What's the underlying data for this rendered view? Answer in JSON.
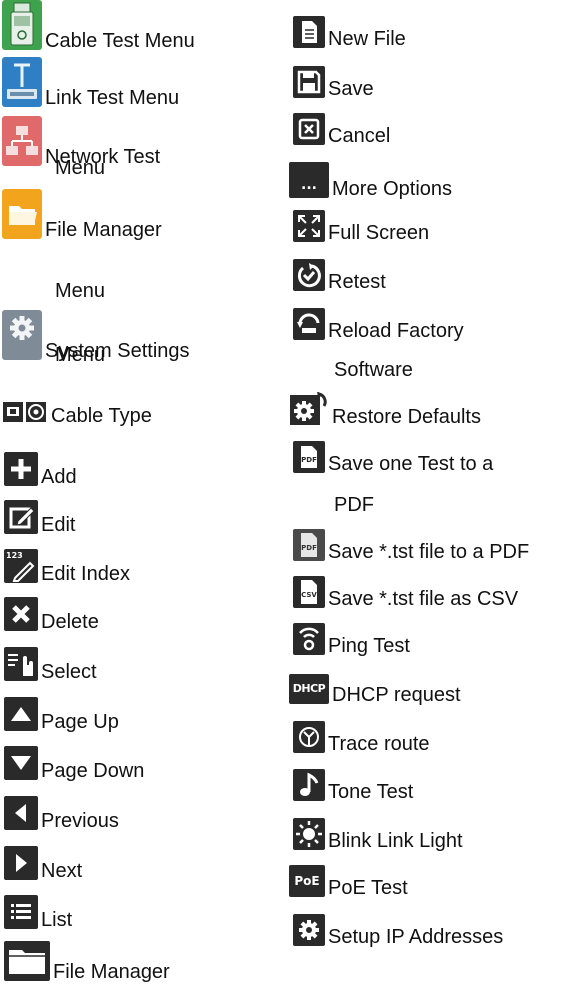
{
  "left_column": [
    {
      "icon": "cable-tester-icon",
      "label": "Cable Test Menu"
    },
    {
      "icon": "link-test-icon",
      "label": "Link Test Menu"
    },
    {
      "icon": "network-topology-icon",
      "label": "Network Test",
      "label_cont": "Menu"
    },
    {
      "icon": "folder-icon",
      "label": "File Manager",
      "label_cont": "Menu"
    },
    {
      "icon": "gear-icon",
      "label": "System Settings",
      "label_cont": "Menu"
    },
    {
      "icon": "cable-type-icon",
      "label": "Cable Type"
    },
    {
      "icon": "plus-icon",
      "label": "Add"
    },
    {
      "icon": "edit-icon",
      "label": "Edit"
    },
    {
      "icon": "edit-index-icon",
      "label": "Edit Index",
      "icon_text": "123"
    },
    {
      "icon": "delete-icon",
      "label": "Delete"
    },
    {
      "icon": "select-icon",
      "label": "Select"
    },
    {
      "icon": "triangle-up-icon",
      "label": "Page Up"
    },
    {
      "icon": "triangle-down-icon",
      "label": "Page Down"
    },
    {
      "icon": "triangle-left-icon",
      "label": "Previous"
    },
    {
      "icon": "triangle-right-icon",
      "label": "Next"
    },
    {
      "icon": "list-icon",
      "label": "List"
    },
    {
      "icon": "file-manager-folder-icon",
      "label": "File Manager"
    }
  ],
  "right_column": [
    {
      "icon": "new-file-icon",
      "label": "New File"
    },
    {
      "icon": "floppy-disk-icon",
      "label": "Save"
    },
    {
      "icon": "cancel-box-icon",
      "label": "Cancel"
    },
    {
      "icon": "ellipsis-icon",
      "label": "More Options",
      "icon_text": "..."
    },
    {
      "icon": "full-screen-icon",
      "label": "Full Screen"
    },
    {
      "icon": "retest-icon",
      "label": "Retest"
    },
    {
      "icon": "reload-software-icon",
      "label": "Reload Factory",
      "label_cont": "Software"
    },
    {
      "icon": "restore-defaults-icon",
      "label": "Restore Defaults"
    },
    {
      "icon": "pdf-file-icon",
      "label": "Save one Test to a",
      "label_cont": "PDF",
      "icon_text": "PDF"
    },
    {
      "icon": "pdf-file-light-icon",
      "label": "Save *.tst file to a PDF",
      "icon_text": "PDF"
    },
    {
      "icon": "csv-file-icon",
      "label": "Save *.tst file as CSV",
      "icon_text": "CSV"
    },
    {
      "icon": "ping-icon",
      "label": "Ping Test"
    },
    {
      "icon": "dhcp-icon",
      "label": "DHCP request",
      "icon_text": "DHCP"
    },
    {
      "icon": "trace-route-icon",
      "label": "Trace route"
    },
    {
      "icon": "tone-note-icon",
      "label": "Tone Test"
    },
    {
      "icon": "blink-light-icon",
      "label": "Blink Link Light"
    },
    {
      "icon": "poe-icon",
      "label": "PoE Test",
      "icon_text": "PoE"
    },
    {
      "icon": "setup-ip-gear-icon",
      "label": "Setup IP Addresses"
    }
  ]
}
